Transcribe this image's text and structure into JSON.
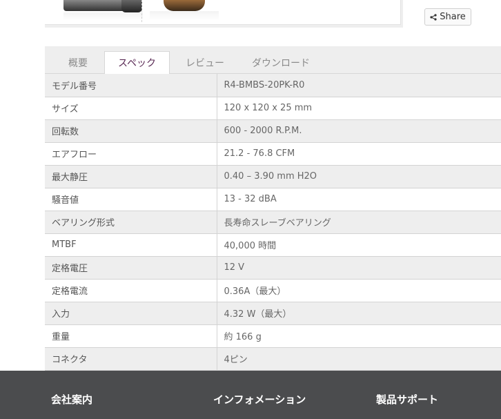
{
  "share": {
    "label": "Share",
    "icon": "share-icon"
  },
  "tabs": [
    {
      "label": "概要",
      "active": false
    },
    {
      "label": "スペック",
      "active": true
    },
    {
      "label": "レビュー",
      "active": false
    },
    {
      "label": "ダウンロード",
      "active": false
    }
  ],
  "specs": [
    {
      "label": "モデル番号",
      "value": "R4-BMBS-20PK-R0"
    },
    {
      "label": "サイズ",
      "value": "120 x 120 x 25 mm"
    },
    {
      "label": "回転数",
      "value": "600 - 2000 R.P.M."
    },
    {
      "label": "エアフロー",
      "value": "21.2 - 76.8 CFM"
    },
    {
      "label": "最大静圧",
      "value": "0.40 – 3.90 mm H2O"
    },
    {
      "label": "騒音値",
      "value": "13 - 32 dBA"
    },
    {
      "label": "ベアリング形式",
      "value": "長寿命スレーブベアリング"
    },
    {
      "label": "MTBF",
      "value": "40,000 時間"
    },
    {
      "label": "定格電圧",
      "value": "12 V"
    },
    {
      "label": "定格電流",
      "value": "0.36A（最大）"
    },
    {
      "label": "入力",
      "value": "4.32 W（最大）"
    },
    {
      "label": "重量",
      "value": "約 166 g"
    },
    {
      "label": "コネクタ",
      "value": "4ピン"
    }
  ],
  "footer": {
    "columns": [
      {
        "heading": "会社案内"
      },
      {
        "heading": "インフォメーション"
      },
      {
        "heading": "製品サポート"
      }
    ]
  },
  "colors": {
    "active_tab_text": "#5a2a55",
    "footer_bg": "#4b4c4e",
    "row_alt": "#eeeeee"
  }
}
